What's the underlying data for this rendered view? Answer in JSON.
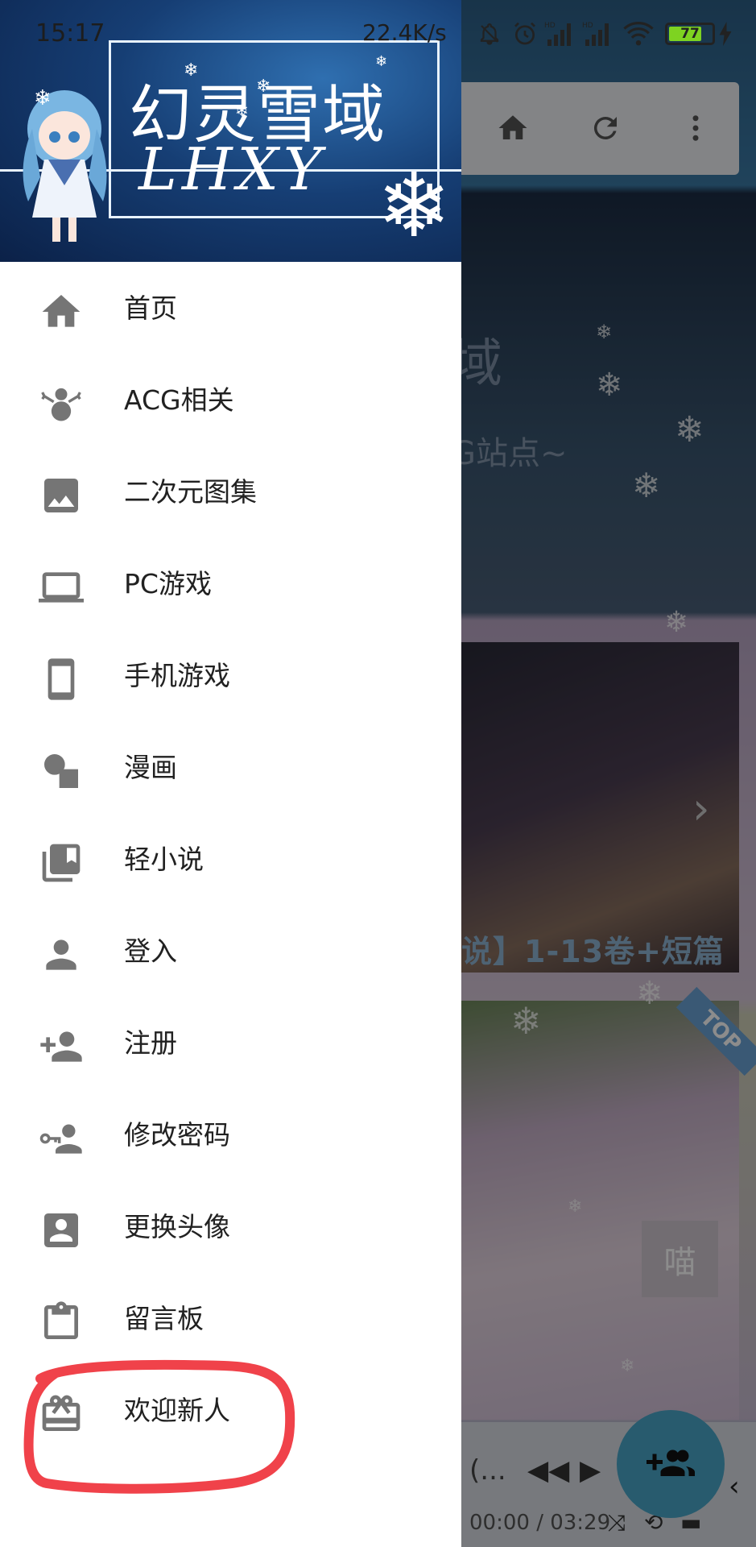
{
  "status_bar": {
    "time": "15:17",
    "network_speed": "22.4K/s",
    "battery_level": "77"
  },
  "drawer": {
    "header_title": "幻灵雪域",
    "header_subtitle": "LHXY",
    "items": [
      {
        "label": "首页",
        "icon": "home-icon"
      },
      {
        "label": "ACG相关",
        "icon": "snowman-icon"
      },
      {
        "label": "二次元图集",
        "icon": "image-icon"
      },
      {
        "label": "PC游戏",
        "icon": "laptop-icon"
      },
      {
        "label": "手机游戏",
        "icon": "smartphone-icon"
      },
      {
        "label": "漫画",
        "icon": "shapes-icon"
      },
      {
        "label": "轻小说",
        "icon": "library-books-icon"
      },
      {
        "label": "登入",
        "icon": "person-icon"
      },
      {
        "label": "注册",
        "icon": "person-add-icon"
      },
      {
        "label": "修改密码",
        "icon": "key-person-icon"
      },
      {
        "label": "更换头像",
        "icon": "account-box-icon"
      },
      {
        "label": "留言板",
        "icon": "clipboard-icon"
      },
      {
        "label": "欢迎新人",
        "icon": "gift-icon"
      }
    ],
    "highlighted_item": "欢迎新人"
  },
  "background_page": {
    "hero_title": "域",
    "hero_subtitle": "G站点~",
    "card1_caption": "说】1-13卷+短篇",
    "badge_top": "TOP",
    "meow_button": "喵",
    "player_title": "(...",
    "player_time": "00:00 / 03:29"
  },
  "colors": {
    "drawer_icon": "#757575",
    "drawer_text": "#212121",
    "annotation": "#f0424a",
    "fab": "#4aa6c9"
  }
}
